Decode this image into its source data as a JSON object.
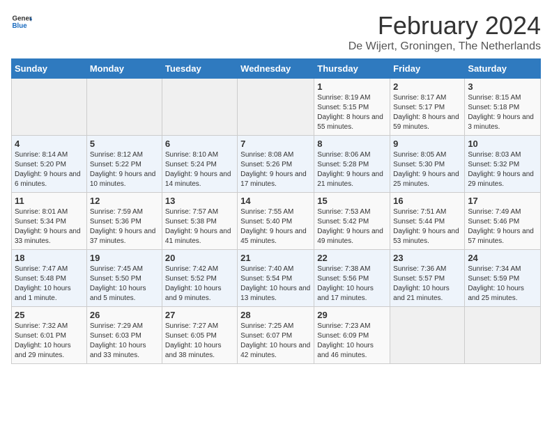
{
  "header": {
    "logo_general": "General",
    "logo_blue": "Blue",
    "title": "February 2024",
    "subtitle": "De Wijert, Groningen, The Netherlands"
  },
  "days_of_week": [
    "Sunday",
    "Monday",
    "Tuesday",
    "Wednesday",
    "Thursday",
    "Friday",
    "Saturday"
  ],
  "weeks": [
    [
      {
        "day": "",
        "info": ""
      },
      {
        "day": "",
        "info": ""
      },
      {
        "day": "",
        "info": ""
      },
      {
        "day": "",
        "info": ""
      },
      {
        "day": "1",
        "info": "Sunrise: 8:19 AM\nSunset: 5:15 PM\nDaylight: 8 hours and 55 minutes."
      },
      {
        "day": "2",
        "info": "Sunrise: 8:17 AM\nSunset: 5:17 PM\nDaylight: 8 hours and 59 minutes."
      },
      {
        "day": "3",
        "info": "Sunrise: 8:15 AM\nSunset: 5:18 PM\nDaylight: 9 hours and 3 minutes."
      }
    ],
    [
      {
        "day": "4",
        "info": "Sunrise: 8:14 AM\nSunset: 5:20 PM\nDaylight: 9 hours and 6 minutes."
      },
      {
        "day": "5",
        "info": "Sunrise: 8:12 AM\nSunset: 5:22 PM\nDaylight: 9 hours and 10 minutes."
      },
      {
        "day": "6",
        "info": "Sunrise: 8:10 AM\nSunset: 5:24 PM\nDaylight: 9 hours and 14 minutes."
      },
      {
        "day": "7",
        "info": "Sunrise: 8:08 AM\nSunset: 5:26 PM\nDaylight: 9 hours and 17 minutes."
      },
      {
        "day": "8",
        "info": "Sunrise: 8:06 AM\nSunset: 5:28 PM\nDaylight: 9 hours and 21 minutes."
      },
      {
        "day": "9",
        "info": "Sunrise: 8:05 AM\nSunset: 5:30 PM\nDaylight: 9 hours and 25 minutes."
      },
      {
        "day": "10",
        "info": "Sunrise: 8:03 AM\nSunset: 5:32 PM\nDaylight: 9 hours and 29 minutes."
      }
    ],
    [
      {
        "day": "11",
        "info": "Sunrise: 8:01 AM\nSunset: 5:34 PM\nDaylight: 9 hours and 33 minutes."
      },
      {
        "day": "12",
        "info": "Sunrise: 7:59 AM\nSunset: 5:36 PM\nDaylight: 9 hours and 37 minutes."
      },
      {
        "day": "13",
        "info": "Sunrise: 7:57 AM\nSunset: 5:38 PM\nDaylight: 9 hours and 41 minutes."
      },
      {
        "day": "14",
        "info": "Sunrise: 7:55 AM\nSunset: 5:40 PM\nDaylight: 9 hours and 45 minutes."
      },
      {
        "day": "15",
        "info": "Sunrise: 7:53 AM\nSunset: 5:42 PM\nDaylight: 9 hours and 49 minutes."
      },
      {
        "day": "16",
        "info": "Sunrise: 7:51 AM\nSunset: 5:44 PM\nDaylight: 9 hours and 53 minutes."
      },
      {
        "day": "17",
        "info": "Sunrise: 7:49 AM\nSunset: 5:46 PM\nDaylight: 9 hours and 57 minutes."
      }
    ],
    [
      {
        "day": "18",
        "info": "Sunrise: 7:47 AM\nSunset: 5:48 PM\nDaylight: 10 hours and 1 minute."
      },
      {
        "day": "19",
        "info": "Sunrise: 7:45 AM\nSunset: 5:50 PM\nDaylight: 10 hours and 5 minutes."
      },
      {
        "day": "20",
        "info": "Sunrise: 7:42 AM\nSunset: 5:52 PM\nDaylight: 10 hours and 9 minutes."
      },
      {
        "day": "21",
        "info": "Sunrise: 7:40 AM\nSunset: 5:54 PM\nDaylight: 10 hours and 13 minutes."
      },
      {
        "day": "22",
        "info": "Sunrise: 7:38 AM\nSunset: 5:56 PM\nDaylight: 10 hours and 17 minutes."
      },
      {
        "day": "23",
        "info": "Sunrise: 7:36 AM\nSunset: 5:57 PM\nDaylight: 10 hours and 21 minutes."
      },
      {
        "day": "24",
        "info": "Sunrise: 7:34 AM\nSunset: 5:59 PM\nDaylight: 10 hours and 25 minutes."
      }
    ],
    [
      {
        "day": "25",
        "info": "Sunrise: 7:32 AM\nSunset: 6:01 PM\nDaylight: 10 hours and 29 minutes."
      },
      {
        "day": "26",
        "info": "Sunrise: 7:29 AM\nSunset: 6:03 PM\nDaylight: 10 hours and 33 minutes."
      },
      {
        "day": "27",
        "info": "Sunrise: 7:27 AM\nSunset: 6:05 PM\nDaylight: 10 hours and 38 minutes."
      },
      {
        "day": "28",
        "info": "Sunrise: 7:25 AM\nSunset: 6:07 PM\nDaylight: 10 hours and 42 minutes."
      },
      {
        "day": "29",
        "info": "Sunrise: 7:23 AM\nSunset: 6:09 PM\nDaylight: 10 hours and 46 minutes."
      },
      {
        "day": "",
        "info": ""
      },
      {
        "day": "",
        "info": ""
      }
    ]
  ]
}
